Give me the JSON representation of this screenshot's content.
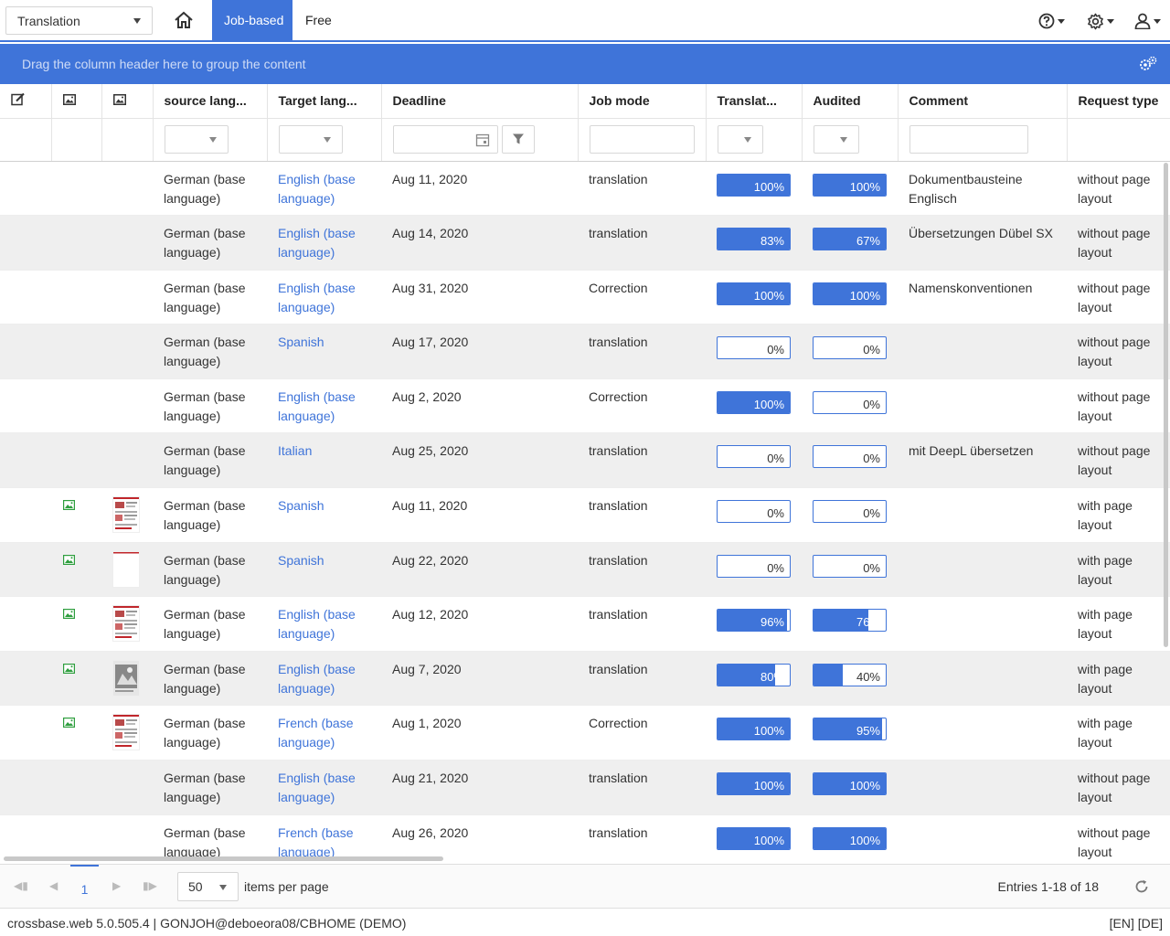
{
  "topbar": {
    "module": "Translation",
    "tabs": [
      {
        "label": "Job-based",
        "active": true
      },
      {
        "label": "Free",
        "active": false
      }
    ]
  },
  "groupbar": {
    "hint": "Drag the column header here to group the content"
  },
  "columns": [
    "source lang...",
    "Target lang...",
    "Deadline",
    "Job mode",
    "Translat...",
    "Audited",
    "Comment",
    "Request type"
  ],
  "rows": [
    {
      "source": "German (base language)",
      "target": "English (base language)",
      "deadline": "Aug 11, 2020",
      "mode": "translation",
      "translated": 100,
      "translated_label": "100%",
      "audited": 100,
      "audited_label": "100%",
      "comment": "Dokumentbausteine Englisch",
      "request": "without page layout",
      "image": false
    },
    {
      "source": "German (base language)",
      "target": "English (base language)",
      "deadline": "Aug 14, 2020",
      "mode": "translation",
      "translated": 100,
      "translated_label": "83%",
      "audited": 100,
      "audited_label": "67%",
      "comment": "Übersetzungen Dübel SX",
      "request": "without page layout",
      "image": false
    },
    {
      "source": "German (base language)",
      "target": "English (base language)",
      "deadline": "Aug 31, 2020",
      "mode": "Correction",
      "translated": 100,
      "translated_label": "100%",
      "audited": 100,
      "audited_label": "100%",
      "comment": "Namenskonventionen",
      "request": "without page layout",
      "image": false
    },
    {
      "source": "German (base language)",
      "target": "Spanish",
      "deadline": "Aug 17, 2020",
      "mode": "translation",
      "translated": 0,
      "translated_label": "0%",
      "audited": 0,
      "audited_label": "0%",
      "comment": "",
      "request": "without page layout",
      "image": false
    },
    {
      "source": "German (base language)",
      "target": "English (base language)",
      "deadline": "Aug 2, 2020",
      "mode": "Correction",
      "translated": 100,
      "translated_label": "100%",
      "audited": 0,
      "audited_label": "0%",
      "comment": "",
      "request": "without page layout",
      "image": false
    },
    {
      "source": "German (base language)",
      "target": "Italian",
      "deadline": "Aug 25, 2020",
      "mode": "translation",
      "translated": 0,
      "translated_label": "0%",
      "audited": 0,
      "audited_label": "0%",
      "comment": "mit DeepL übersetzen",
      "request": "without page layout",
      "image": false
    },
    {
      "source": "German (base language)",
      "target": "Spanish",
      "deadline": "Aug 11, 2020",
      "mode": "translation",
      "translated": 0,
      "translated_label": "0%",
      "audited": 0,
      "audited_label": "0%",
      "comment": "",
      "request": "with page layout",
      "image": true,
      "thumb": "doc"
    },
    {
      "source": "German (base language)",
      "target": "Spanish",
      "deadline": "Aug 22, 2020",
      "mode": "translation",
      "translated": 0,
      "translated_label": "0%",
      "audited": 0,
      "audited_label": "0%",
      "comment": "",
      "request": "with page layout",
      "image": true,
      "thumb": "blank"
    },
    {
      "source": "German (base language)",
      "target": "English (base language)",
      "deadline": "Aug 12, 2020",
      "mode": "translation",
      "translated": 96,
      "translated_label": "96%",
      "audited": 76,
      "audited_label": "76%",
      "comment": "",
      "request": "with page layout",
      "image": true,
      "thumb": "doc"
    },
    {
      "source": "German (base language)",
      "target": "English (base language)",
      "deadline": "Aug 7, 2020",
      "mode": "translation",
      "translated": 80,
      "translated_label": "80%",
      "audited": 40,
      "audited_label": "40%",
      "comment": "",
      "request": "with page layout",
      "image": true,
      "thumb": "photo"
    },
    {
      "source": "German (base language)",
      "target": "French (base language)",
      "deadline": "Aug 1, 2020",
      "mode": "Correction",
      "translated": 100,
      "translated_label": "100%",
      "audited": 95,
      "audited_label": "95%",
      "comment": "",
      "request": "with page layout",
      "image": true,
      "thumb": "doc"
    },
    {
      "source": "German (base language)",
      "target": "English (base language)",
      "deadline": "Aug 21, 2020",
      "mode": "translation",
      "translated": 100,
      "translated_label": "100%",
      "audited": 100,
      "audited_label": "100%",
      "comment": "",
      "request": "without page layout",
      "image": false
    },
    {
      "source": "German (base language)",
      "target": "French (base language)",
      "deadline": "Aug 26, 2020",
      "mode": "translation",
      "translated": 100,
      "translated_label": "100%",
      "audited": 100,
      "audited_label": "100%",
      "comment": "",
      "request": "without page layout",
      "image": false
    }
  ],
  "pager": {
    "page": "1",
    "page_size": "50",
    "page_size_label": "items per page",
    "info": "Entries 1-18 of 18"
  },
  "status": {
    "left": "crossbase.web 5.0.505.4 | GONJOH@deboeora08/CBHOME (DEMO)",
    "right": "[EN] [DE]"
  },
  "colors": {
    "accent": "#3f74d9",
    "row_alt": "#efefef",
    "icon_green": "#2e9e3e"
  }
}
